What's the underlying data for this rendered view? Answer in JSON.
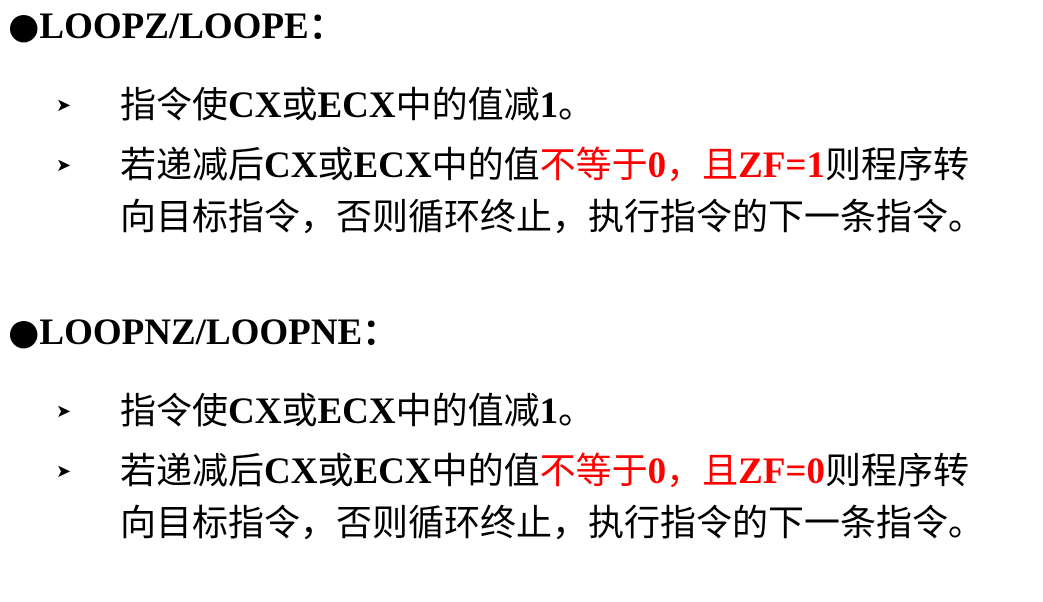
{
  "accent_color": "#ff0000",
  "bullet_icon": "triangle-right-bullet-icon",
  "sections": [
    {
      "heading_dot": "●",
      "heading_mnemonic": "LOOPZ/LOOPE",
      "heading_colon": "：",
      "item1": {
        "a": "指令使",
        "b": "CX",
        "c": "或",
        "d": "ECX",
        "e": "中的值减",
        "f": "1",
        "g": "。"
      },
      "item2": {
        "a": "若递减后",
        "b": "CX",
        "c": "或",
        "d": "ECX",
        "e": "中的值",
        "red1": "不等于",
        "red2": "0",
        "red3": "，且",
        "red4": "ZF=1",
        "f": "则程序转向目标指令，否则循环终止，执行指令的下一条指令。"
      }
    },
    {
      "heading_dot": "●",
      "heading_mnemonic": "LOOPNZ/LOOPNE",
      "heading_colon": "：",
      "item1": {
        "a": "指令使",
        "b": "CX",
        "c": "或",
        "d": "ECX",
        "e": "中的值减",
        "f": "1",
        "g": "。"
      },
      "item2": {
        "a": "若递减后",
        "b": "CX",
        "c": "或",
        "d": "ECX",
        "e": "中的值",
        "red1": "不等于",
        "red2": "0",
        "red3": "，且",
        "red4": "ZF=0",
        "f": "则程序转向目标指令，否则循环终止，执行指令的下一条指令。"
      }
    }
  ]
}
